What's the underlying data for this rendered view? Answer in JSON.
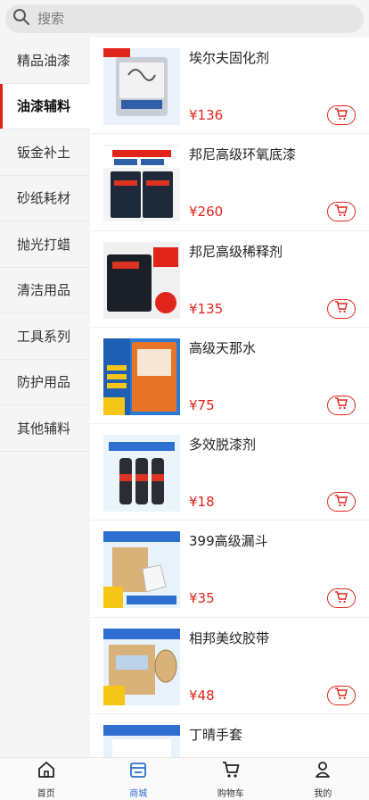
{
  "search": {
    "placeholder": "搜索"
  },
  "sidebar": {
    "items": [
      {
        "label": "精品油漆"
      },
      {
        "label": "油漆辅料"
      },
      {
        "label": "钣金补土"
      },
      {
        "label": "砂纸耗材"
      },
      {
        "label": "抛光打蜡"
      },
      {
        "label": "清洁用品"
      },
      {
        "label": "工具系列"
      },
      {
        "label": "防护用品"
      },
      {
        "label": "其他辅料"
      }
    ]
  },
  "products": [
    {
      "name": "埃尔夫固化剂",
      "price": "¥136"
    },
    {
      "name": "邦尼高级环氧底漆",
      "price": "¥260"
    },
    {
      "name": "邦尼高级稀释剂",
      "price": "¥135"
    },
    {
      "name": "高级天那水",
      "price": "¥75"
    },
    {
      "name": "多效脱漆剂",
      "price": "¥18"
    },
    {
      "name": "399高级漏斗",
      "price": "¥35"
    },
    {
      "name": "相邦美纹胶带",
      "price": "¥48"
    },
    {
      "name": "丁晴手套",
      "price": ""
    }
  ],
  "product_images": {
    "p0": {
      "label1": "正品保证",
      "label2": "德国进口"
    },
    "p1": {
      "label1": "邦尼高级环氧底漆",
      "label2": "超强附着",
      "label3": "干燥快"
    },
    "p2": {
      "label1": "邦尼高级稀释剂",
      "label2": "立即抢购"
    },
    "p3": {
      "label1": "高级天那水",
      "label2": "HANGO RESIN"
    },
    "p4": {
      "label1": "快速除漆",
      "label2": "高效便捷"
    },
    "p5": {
      "label1": "399高级漏斗",
      "label2": "网格细密"
    },
    "p6": {
      "label1": "相邦美纹胶带",
      "label2": "正品保证"
    },
    "p7": {
      "label1": "丁晴手套加厚耐用"
    }
  },
  "tabbar": {
    "items": [
      {
        "label": "首页",
        "icon": "home-icon"
      },
      {
        "label": "商城",
        "icon": "store-icon"
      },
      {
        "label": "购物车",
        "icon": "cart-icon"
      },
      {
        "label": "我的",
        "icon": "user-icon"
      }
    ]
  },
  "colors": {
    "accent": "#e1251b",
    "tab_active": "#2f6fd1"
  }
}
